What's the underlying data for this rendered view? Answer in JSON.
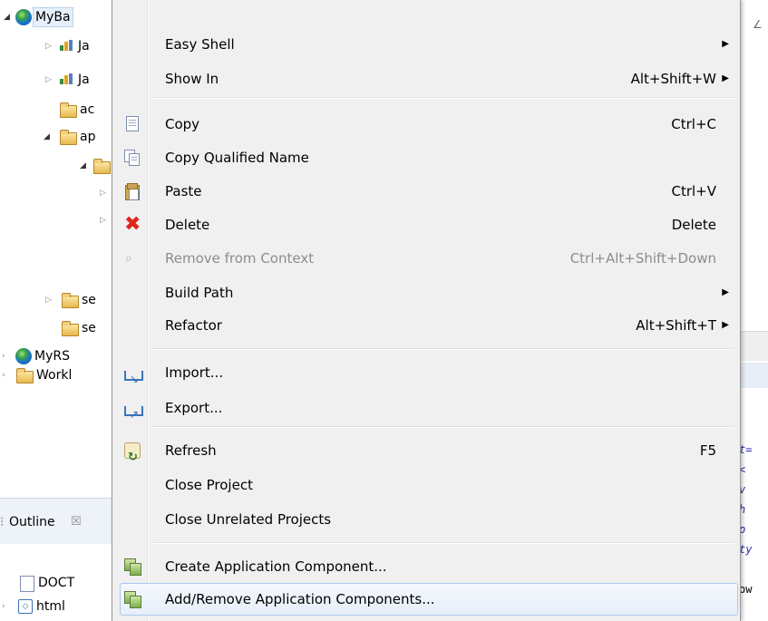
{
  "project_tree": {
    "items": [
      {
        "label": "MyBa",
        "icon": "globe-project-icon"
      },
      {
        "label": "Ja",
        "icon": "library-icon"
      },
      {
        "label": "Ja",
        "icon": "library-icon"
      },
      {
        "label": "ac",
        "icon": "folder-icon"
      },
      {
        "label": "ap",
        "icon": "folder-icon"
      },
      {
        "label": "",
        "icon": "folder-icon"
      },
      {
        "label": "se",
        "icon": "folder-icon"
      },
      {
        "label": "se",
        "icon": "folder-icon"
      },
      {
        "label": "MyRS",
        "icon": "globe-project-icon"
      },
      {
        "label": "Workl",
        "icon": "folder-icon"
      }
    ]
  },
  "outline_view": {
    "title": "Outline",
    "close_glyph": "☒",
    "items": [
      {
        "label": "DOCT",
        "icon": "doctype-icon"
      },
      {
        "label": "html",
        "icon": "html-element-icon"
      }
    ]
  },
  "code_strip": {
    "lines": [
      "t=",
      "<",
      "v",
      "h",
      "p",
      "ty",
      "ow"
    ]
  },
  "context_menu": {
    "items": [
      {
        "label": "Easy Shell",
        "shortcut": "",
        "submenu": true,
        "icon": ""
      },
      {
        "label": "Show In",
        "shortcut": "Alt+Shift+W",
        "submenu": true,
        "icon": ""
      },
      {
        "label": "Copy",
        "shortcut": "Ctrl+C",
        "submenu": false,
        "icon": "copy-icon"
      },
      {
        "label": "Copy Qualified Name",
        "shortcut": "",
        "submenu": false,
        "icon": "copy-qualified-name-icon"
      },
      {
        "label": "Paste",
        "shortcut": "Ctrl+V",
        "submenu": false,
        "icon": "paste-icon"
      },
      {
        "label": "Delete",
        "shortcut": "Delete",
        "submenu": false,
        "icon": "delete-icon"
      },
      {
        "label": "Remove from Context",
        "shortcut": "Ctrl+Alt+Shift+Down",
        "submenu": false,
        "icon": "remove-from-context-icon",
        "disabled": true
      },
      {
        "label": "Build Path",
        "shortcut": "",
        "submenu": true,
        "icon": ""
      },
      {
        "label": "Refactor",
        "shortcut": "Alt+Shift+T",
        "submenu": true,
        "icon": ""
      },
      {
        "label": "Import...",
        "shortcut": "",
        "submenu": false,
        "icon": "import-icon"
      },
      {
        "label": "Export...",
        "shortcut": "",
        "submenu": false,
        "icon": "export-icon"
      },
      {
        "label": "Refresh",
        "shortcut": "F5",
        "submenu": false,
        "icon": "refresh-icon"
      },
      {
        "label": "Close Project",
        "shortcut": "",
        "submenu": false,
        "icon": ""
      },
      {
        "label": "Close Unrelated Projects",
        "shortcut": "",
        "submenu": false,
        "icon": ""
      },
      {
        "label": "Create Application Component...",
        "shortcut": "",
        "submenu": false,
        "icon": "create-application-component-icon"
      },
      {
        "label": "Add/Remove Application Components...",
        "shortcut": "",
        "submenu": false,
        "icon": "add-remove-application-components-icon",
        "highlighted": true
      }
    ],
    "submenu_arrow": "▶"
  }
}
